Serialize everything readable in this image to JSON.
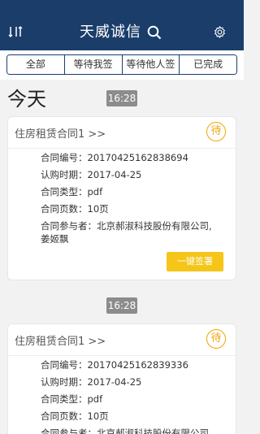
{
  "header": {
    "title": "天威诚信",
    "left_icon": "sort-icon",
    "search_icon": "search-icon",
    "settings_icon": "settings-icon",
    "bg_color": "#1a3d6a"
  },
  "tabs": [
    {
      "label": "全部",
      "active": true
    },
    {
      "label": "等待我签",
      "active": false
    },
    {
      "label": "等待他人签",
      "active": false
    },
    {
      "label": "已完成",
      "active": false
    }
  ],
  "section_title": "今天",
  "cards": [
    {
      "time": "16:28",
      "title": "住房租赁合同1 >>",
      "status": "待",
      "fields": [
        {
          "label": "合同编号：",
          "value": "20170425162838694"
        },
        {
          "label": "认购时期：",
          "value": "2017-04-25"
        },
        {
          "label": "合同类型：",
          "value": "pdf"
        },
        {
          "label": "合同页数：",
          "value": "10页"
        },
        {
          "label": "合同参与者：",
          "value": "北京郝淑科技股份有限公司,"
        },
        {
          "label": "",
          "value": "姜姬飘"
        }
      ],
      "button_label": "一键签署"
    },
    {
      "time": "16:28",
      "title": "住房租赁合同1 >>",
      "status": "待",
      "fields": [
        {
          "label": "合同编号：",
          "value": "20170425162839336"
        },
        {
          "label": "认购时期：",
          "value": "2017-04-25"
        },
        {
          "label": "合同类型：",
          "value": "pdf"
        },
        {
          "label": "合同页数：",
          "value": "10页"
        },
        {
          "label": "合同参与者：",
          "value": "北京郝淑科技股份有限公司"
        }
      ]
    }
  ]
}
